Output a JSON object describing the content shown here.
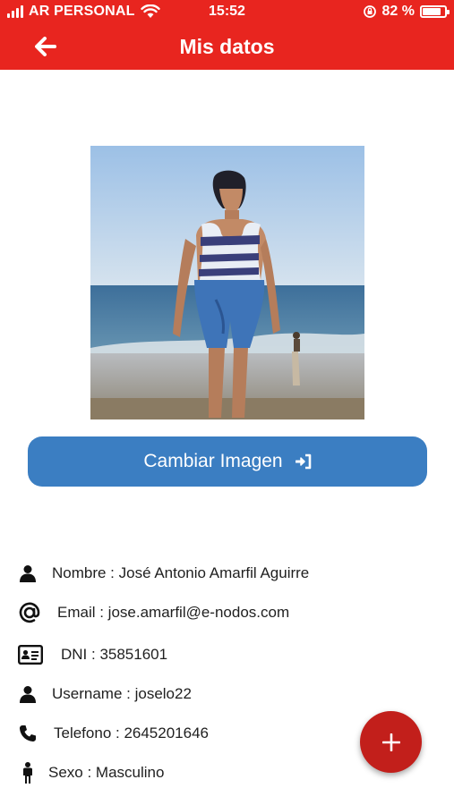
{
  "status_bar": {
    "carrier": "AR PERSONAL",
    "time": "15:52",
    "battery": "82 %",
    "battery_level": 0.82
  },
  "header": {
    "title": "Mis datos",
    "back_icon": "arrow-left-icon",
    "color": "#e8251f"
  },
  "profile": {
    "photo_alt": "Foto de perfil",
    "change_image_label": "Cambiar Imagen",
    "change_image_icon": "sign-in-icon",
    "button_color": "#3b7ec2"
  },
  "details": [
    {
      "icon": "user-icon",
      "text": "Nombre : José Antonio Amarfil Aguirre"
    },
    {
      "icon": "at-icon",
      "text": "Email : jose.amarfil@e-nodos.com"
    },
    {
      "icon": "id-card-icon",
      "text": "DNI : 35851601"
    },
    {
      "icon": "user-icon",
      "text": "Username : joselo22"
    },
    {
      "icon": "phone-icon",
      "text": "Telefono : 2645201646"
    },
    {
      "icon": "male-icon",
      "text": "Sexo : Masculino"
    }
  ],
  "fab": {
    "icon": "plus-icon",
    "color": "#c21f1b"
  }
}
